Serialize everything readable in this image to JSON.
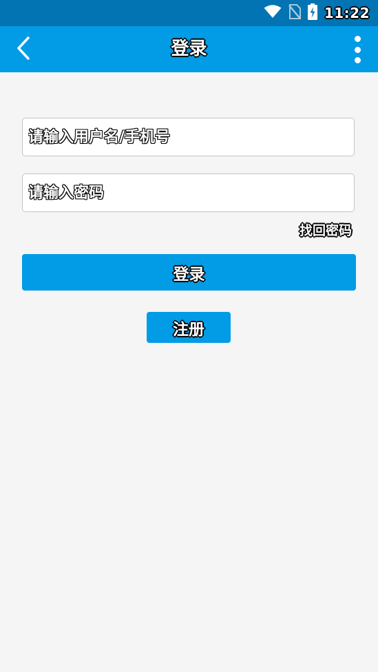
{
  "status_bar": {
    "time": "11:22",
    "icons": [
      "wifi-icon",
      "no-sim-icon",
      "battery-charging-icon"
    ]
  },
  "app_bar": {
    "title": "登录",
    "back_icon": "chevron-left-icon",
    "more_icon": "more-vert-icon"
  },
  "form": {
    "username_placeholder": "请输入用户名/手机号",
    "username_value": "",
    "password_placeholder": "请输入密码",
    "password_value": "",
    "forgot_label": "找回密码",
    "login_label": "登录",
    "register_label": "注册"
  },
  "colors": {
    "status_bar": "#0274b3",
    "primary": "#029be5",
    "background": "#f5f5f5"
  }
}
